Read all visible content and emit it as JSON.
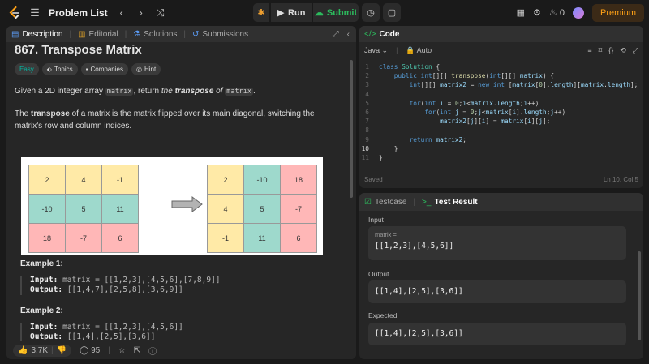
{
  "topbar": {
    "title": "Problem List",
    "run_label": "Run",
    "submit_label": "Submit",
    "streak_count": "0",
    "premium_label": "Premium"
  },
  "left_tabs": [
    "Description",
    "Editorial",
    "Solutions",
    "Submissions"
  ],
  "problem": {
    "title": "867. Transpose Matrix",
    "difficulty": "Easy",
    "chips": [
      "Topics",
      "Companies",
      "Hint"
    ],
    "p1_a": "Given a 2D integer array ",
    "p1_code": "matrix",
    "p1_b": ", return ",
    "p1_em_a": "the ",
    "p1_em_b": "transpose",
    "p1_em_c": " of ",
    "p1_code2": "matrix",
    "p1_c": ".",
    "p2_a": "The ",
    "p2_b": "transpose",
    "p2_c": " of a matrix is the matrix flipped over its main diagonal, switching the matrix's row and column indices.",
    "matrix_a": [
      "2",
      "4",
      "-1",
      "-10",
      "5",
      "11",
      "18",
      "-7",
      "6"
    ],
    "matrix_b": [
      "2",
      "-10",
      "18",
      "4",
      "5",
      "-7",
      "-1",
      "11",
      "6"
    ],
    "example1_title": "Example 1:",
    "example1_input_label": "Input:",
    "example1_input": "matrix = [[1,2,3],[4,5,6],[7,8,9]]",
    "example1_output_label": "Output:",
    "example1_output": "[[1,4,7],[2,5,8],[3,6,9]]",
    "example2_title": "Example 2:",
    "example2_input_label": "Input:",
    "example2_input": "matrix = [[1,2,3],[4,5,6]]",
    "example2_output_label": "Output:",
    "example2_output": "[[1,4],[2,5],[3,6]]"
  },
  "footer": {
    "likes": "3.7K",
    "comments": "95"
  },
  "code_panel": {
    "tab_label": "Code",
    "language": "Java",
    "auto_label": "Auto",
    "saved_label": "Saved",
    "cursor_pos": "Ln 10, Col 5"
  },
  "code_lines": [
    "class Solution {",
    "    public int[][] transpose(int[][] matrix) {",
    "        int[][] matrix2 = new int [matrix[0].length][matrix.length];",
    "",
    "        for(int i = 0;i<matrix.length;i++)",
    "            for(int j = 0;j<matrix[i].length;j++)",
    "                matrix2[j][i] = matrix[i][j];",
    "",
    "        return matrix2;",
    "    }",
    "}"
  ],
  "test_panel": {
    "tab_testcase": "Testcase",
    "tab_result": "Test Result",
    "input_label": "Input",
    "input_var": "matrix =",
    "input_value": "[[1,2,3],[4,5,6]]",
    "output_label": "Output",
    "output_value": "[[1,4],[2,5],[3,6]]",
    "expected_label": "Expected",
    "expected_value": "[[1,4],[2,5],[3,6]]"
  }
}
